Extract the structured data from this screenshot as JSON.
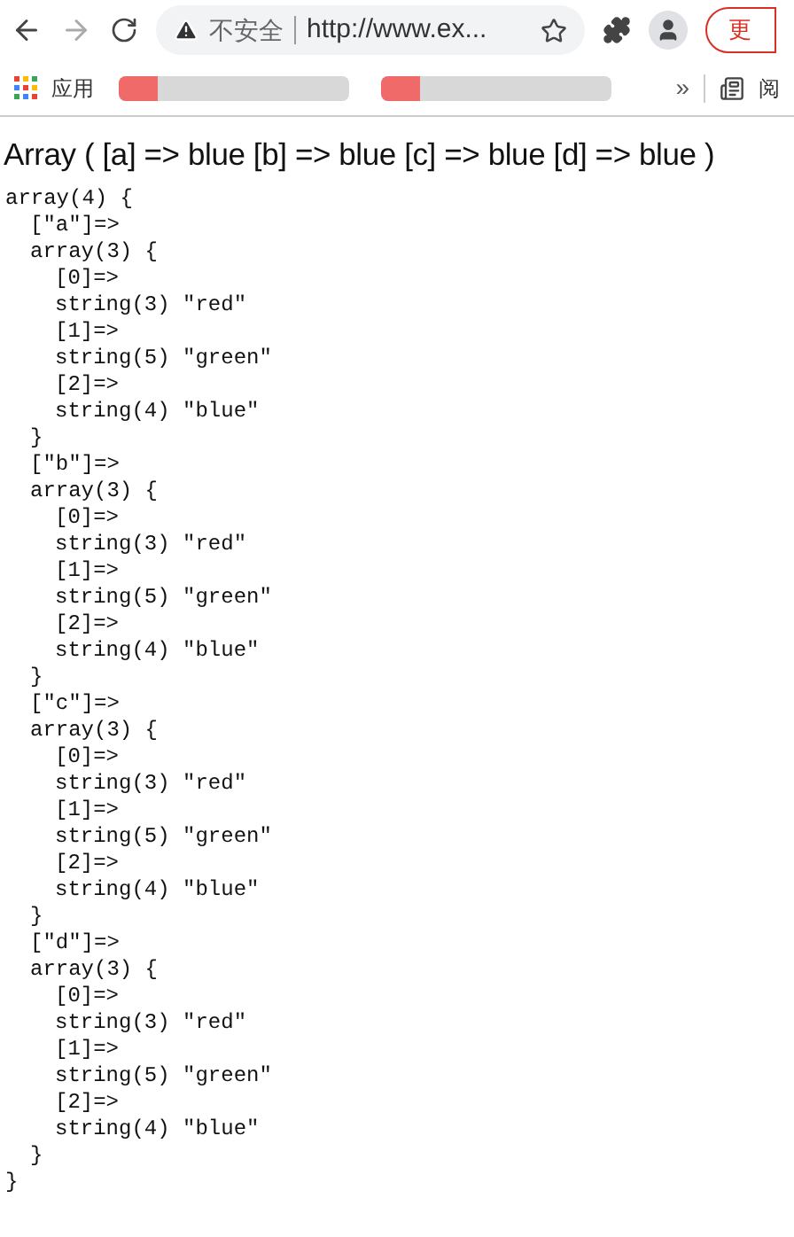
{
  "browser": {
    "security_label": "不安全",
    "url": "http://www.ex...",
    "update_button": "更",
    "bookmarks_label": "应用",
    "bookmarks": [
      {
        "kind": "blurred",
        "color": "#f06a6a"
      },
      {
        "kind": "blurred",
        "color": "#f06a6a"
      }
    ],
    "more": "»",
    "reading_list": "阅"
  },
  "heading": "Array ( [a] => blue [b] => blue [c] => blue [d] => blue )",
  "dump": [
    {
      "text": "array(4) {",
      "children": [
        {
          "text": "[\"a\"]=>"
        },
        {
          "text": "array(3) {",
          "children": [
            {
              "text": "[0]=>"
            },
            {
              "text": "string(3) \"red\""
            },
            {
              "text": "[1]=>"
            },
            {
              "text": "string(5) \"green\""
            },
            {
              "text": "[2]=>"
            },
            {
              "text": "string(4) \"blue\""
            }
          ]
        },
        {
          "text": "}"
        },
        {
          "text": "[\"b\"]=>"
        },
        {
          "text": "array(3) {",
          "children": [
            {
              "text": "[0]=>"
            },
            {
              "text": "string(3) \"red\""
            },
            {
              "text": "[1]=>"
            },
            {
              "text": "string(5) \"green\""
            },
            {
              "text": "[2]=>"
            },
            {
              "text": "string(4) \"blue\""
            }
          ]
        },
        {
          "text": "}"
        },
        {
          "text": "[\"c\"]=>"
        },
        {
          "text": "array(3) {",
          "children": [
            {
              "text": "[0]=>"
            },
            {
              "text": "string(3) \"red\""
            },
            {
              "text": "[1]=>"
            },
            {
              "text": "string(5) \"green\""
            },
            {
              "text": "[2]=>"
            },
            {
              "text": "string(4) \"blue\""
            }
          ]
        },
        {
          "text": "}"
        },
        {
          "text": "[\"d\"]=>"
        },
        {
          "text": "array(3) {",
          "children": [
            {
              "text": "[0]=>"
            },
            {
              "text": "string(3) \"red\""
            },
            {
              "text": "[1]=>"
            },
            {
              "text": "string(5) \"green\""
            },
            {
              "text": "[2]=>"
            },
            {
              "text": "string(4) \"blue\""
            }
          ]
        },
        {
          "text": "}"
        }
      ]
    },
    {
      "text": "}"
    }
  ]
}
